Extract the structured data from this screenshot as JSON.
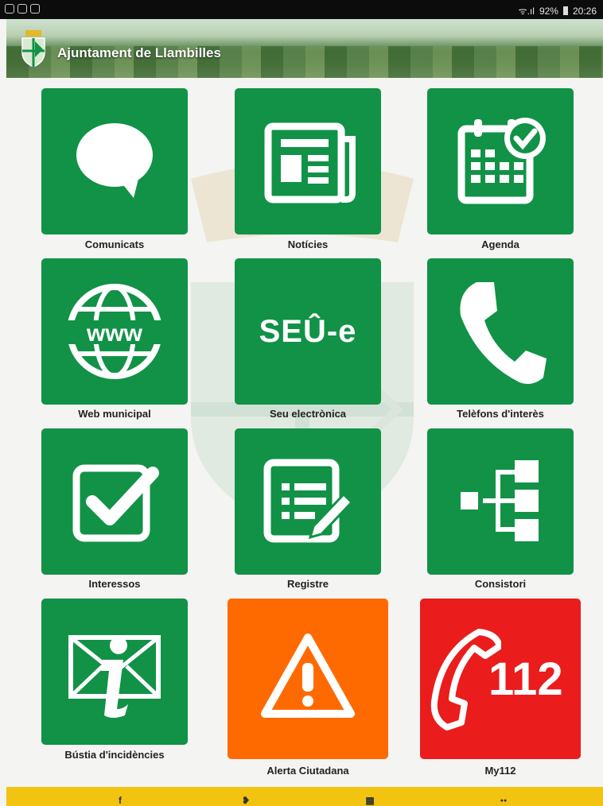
{
  "status_bar": {
    "signal_text": "ᯤ.ıl",
    "battery": "92%",
    "time": "20:26"
  },
  "header": {
    "title": "Ajuntament de Llambilles"
  },
  "tiles": [
    {
      "label": "Comunicats",
      "icon": "speech-bubble-icon",
      "color": "#119247"
    },
    {
      "label": "Notícies",
      "icon": "newspaper-icon",
      "color": "#119247"
    },
    {
      "label": "Agenda",
      "icon": "calendar-check-icon",
      "color": "#119247"
    },
    {
      "label": "Web municipal",
      "icon": "globe-www-icon",
      "color": "#119247"
    },
    {
      "label": "Seu electrònica",
      "icon": "seu-e-icon",
      "icon_text": "SEÛ-e",
      "color": "#119247"
    },
    {
      "label": "Telèfons d'interès",
      "icon": "phone-icon",
      "color": "#119247"
    },
    {
      "label": "Interessos",
      "icon": "checkbox-icon",
      "color": "#119247"
    },
    {
      "label": "Registre",
      "icon": "form-edit-icon",
      "color": "#119247"
    },
    {
      "label": "Consistori",
      "icon": "org-chart-icon",
      "color": "#119247"
    },
    {
      "label": "Bústia d'incidències",
      "icon": "mail-info-icon",
      "color": "#119247"
    },
    {
      "label": "Alerta Ciutadana",
      "icon": "warning-icon",
      "color": "#ff6a00"
    },
    {
      "label": "My112",
      "icon": "emergency-112-icon",
      "icon_text": "112",
      "color": "#ea1c1c"
    }
  ],
  "footer": {
    "background": "#f2c411",
    "icons": [
      {
        "name": "facebook-icon",
        "glyph": "f"
      },
      {
        "name": "twitter-icon",
        "glyph": "❥"
      },
      {
        "name": "gallery-icon",
        "glyph": "▦"
      },
      {
        "name": "flickr-icon",
        "glyph": "●●"
      }
    ]
  }
}
